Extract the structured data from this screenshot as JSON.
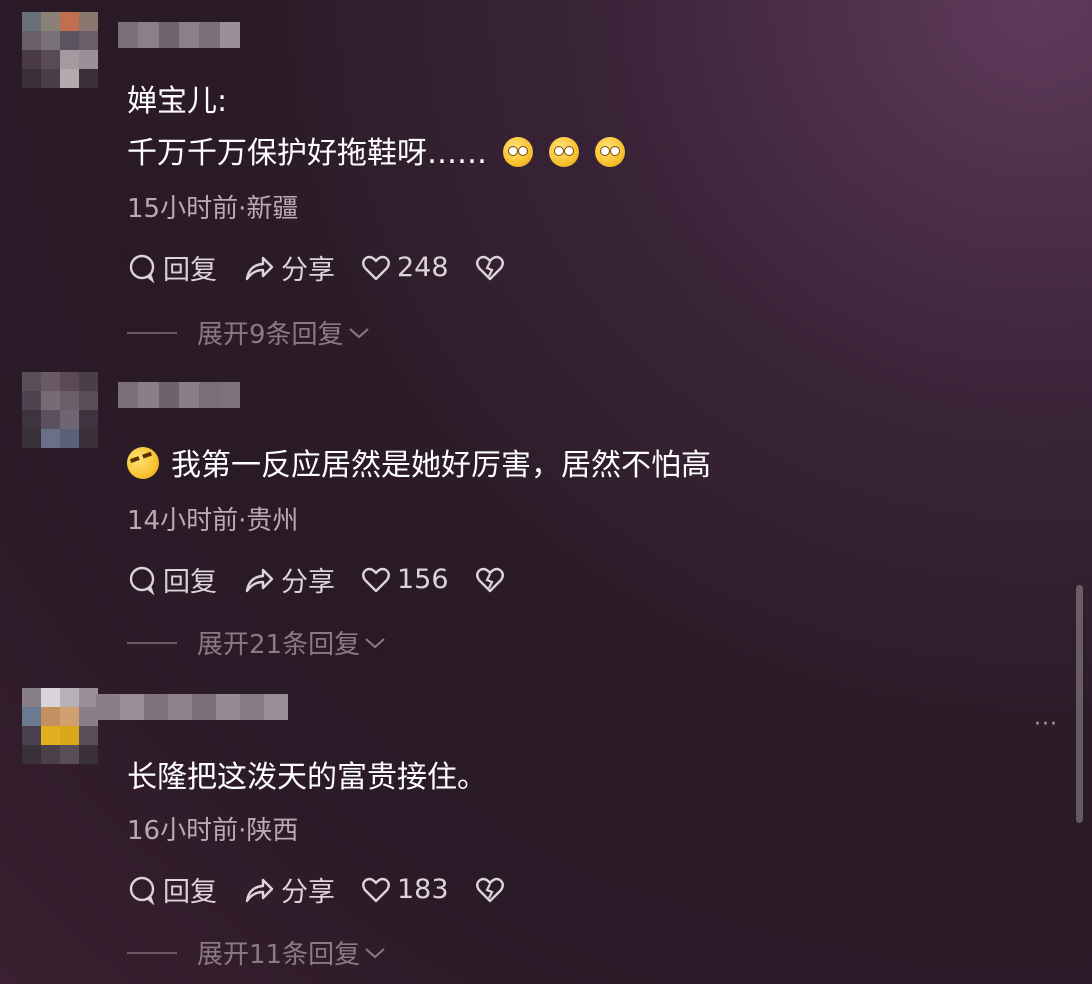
{
  "comments": [
    {
      "username": "婵宝儿:",
      "text": "千万千万保护好拖鞋呀……",
      "meta": "15小时前·新疆",
      "reply_label": "回复",
      "share_label": "分享",
      "likes": "248",
      "expand_label": "展开9条回复"
    },
    {
      "text": "我第一反应居然是她好厉害，居然不怕高",
      "meta": "14小时前·贵州",
      "reply_label": "回复",
      "share_label": "分享",
      "likes": "156",
      "expand_label": "展开21条回复"
    },
    {
      "text": "长隆把这泼天的富贵接住。",
      "meta": "16小时前·陕西",
      "reply_label": "回复",
      "share_label": "分享",
      "likes": "183",
      "expand_label": "展开11条回复"
    }
  ],
  "more_label": "···",
  "colors": {
    "accent_text": "#ffffff",
    "meta": "#b9aab5",
    "muted": "#8a7a86"
  },
  "icons": [
    "reply-bubble-icon",
    "share-arrow-icon",
    "heart-icon",
    "broken-heart-icon",
    "chevron-down-icon",
    "emoji-icon"
  ]
}
